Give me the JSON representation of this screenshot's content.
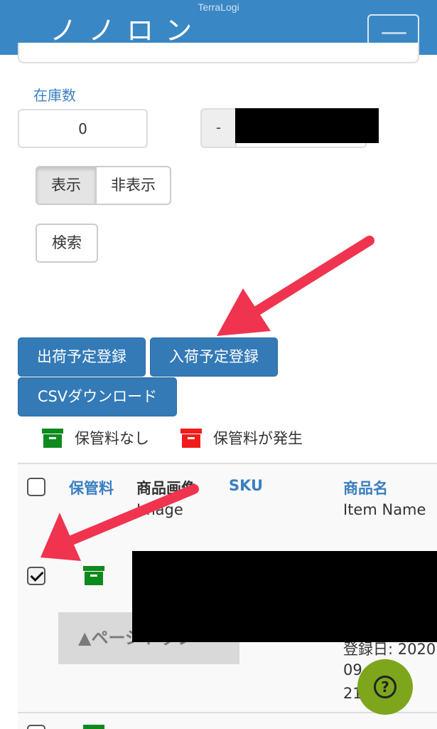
{
  "header": {
    "brand": "TerraLogi",
    "title_partial": "ノ ノ ロ ン"
  },
  "filters": {
    "stock_label": "在庫数",
    "stock_value": "0",
    "range_separator": "-",
    "toggle_show": "表示",
    "toggle_hide": "非表示",
    "search_button": "検索"
  },
  "actions": {
    "shipment_button": "出荷予定登録",
    "arrival_button": "入荷予定登録",
    "csv_button": "CSVダウンロード"
  },
  "legend": {
    "no_fee": "保管料なし",
    "fee_incurred": "保管料が発生"
  },
  "table": {
    "headers": {
      "fee": "保管料",
      "image": "商品画像",
      "image_sub": "Image",
      "sku": "SKU",
      "name": "商品名",
      "name_sub": "Item Name"
    },
    "row1": {
      "checked": true,
      "date_line1": "登録日: 2020",
      "date_line2": "09-",
      "date_line3": "21"
    }
  },
  "overlays": {
    "page_top": "▲ページトップ",
    "help": "?"
  },
  "colors": {
    "header_bg": "#3a87c5",
    "primary_button": "#337ab7",
    "fee_none": "#0d8a1c",
    "fee_incurred": "#f21b1b",
    "help_button": "#7da61d",
    "annotation_arrow": "#f0344f"
  }
}
